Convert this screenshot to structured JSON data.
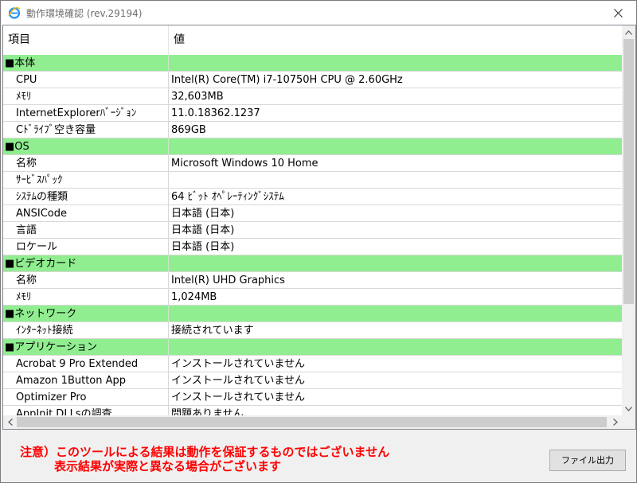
{
  "window": {
    "title": "動作環境確認 (rev.29194)",
    "icon": "ie-icon",
    "close_icon": "close-icon"
  },
  "table": {
    "columns": [
      "項目",
      "値"
    ],
    "rows": [
      {
        "type": "section",
        "name": "■本体",
        "value": ""
      },
      {
        "type": "item",
        "name": "CPU",
        "value": "Intel(R) Core(TM) i7-10750H CPU @ 2.60GHz"
      },
      {
        "type": "item",
        "name": "ﾒﾓﾘ",
        "value": "32,603MB"
      },
      {
        "type": "item",
        "name": "InternetExplorerﾊﾞｰｼﾞｮﾝ",
        "value": "11.0.18362.1237"
      },
      {
        "type": "item",
        "name": "Cﾄﾞﾗｲﾌﾞ空き容量",
        "value": "869GB"
      },
      {
        "type": "section",
        "name": "■OS",
        "value": ""
      },
      {
        "type": "item",
        "name": "名称",
        "value": "Microsoft Windows 10 Home"
      },
      {
        "type": "item",
        "name": "ｻｰﾋﾞｽﾊﾟｯｸ",
        "value": ""
      },
      {
        "type": "item",
        "name": "ｼｽﾃﾑの種類",
        "value": "64 ﾋﾞｯﾄ ｵﾍﾟﾚｰﾃｨﾝｸﾞｼｽﾃﾑ"
      },
      {
        "type": "item",
        "name": "ANSICode",
        "value": "日本語 (日本)"
      },
      {
        "type": "item",
        "name": "言語",
        "value": "日本語 (日本)"
      },
      {
        "type": "item",
        "name": "ロケール",
        "value": "日本語 (日本)"
      },
      {
        "type": "section",
        "name": "■ビデオカード",
        "value": ""
      },
      {
        "type": "item",
        "name": "名称",
        "value": "Intel(R) UHD Graphics"
      },
      {
        "type": "item",
        "name": "ﾒﾓﾘ",
        "value": "1,024MB"
      },
      {
        "type": "section",
        "name": "■ネットワーク",
        "value": ""
      },
      {
        "type": "item",
        "name": "ｲﾝﾀｰﾈｯﾄ接続",
        "value": "接続されています"
      },
      {
        "type": "section",
        "name": "■アプリケーション",
        "value": ""
      },
      {
        "type": "item",
        "name": "Acrobat 9 Pro Extended",
        "value": "インストールされていません"
      },
      {
        "type": "item",
        "name": "Amazon 1Button App",
        "value": "インストールされていません"
      },
      {
        "type": "item",
        "name": "Optimizer Pro",
        "value": "インストールされていません"
      },
      {
        "type": "item",
        "name": "AppInit DLLsの調査",
        "value": "問題ありません"
      }
    ]
  },
  "notice": {
    "line1": "注意）このツールによる結果は動作を保証するものではございません",
    "line2": "表示結果が実際と異なる場合がございます"
  },
  "buttons": {
    "file_output": "ファイル出力"
  },
  "colors": {
    "section_bg": "#90ee90",
    "notice_text": "#ff0000"
  }
}
